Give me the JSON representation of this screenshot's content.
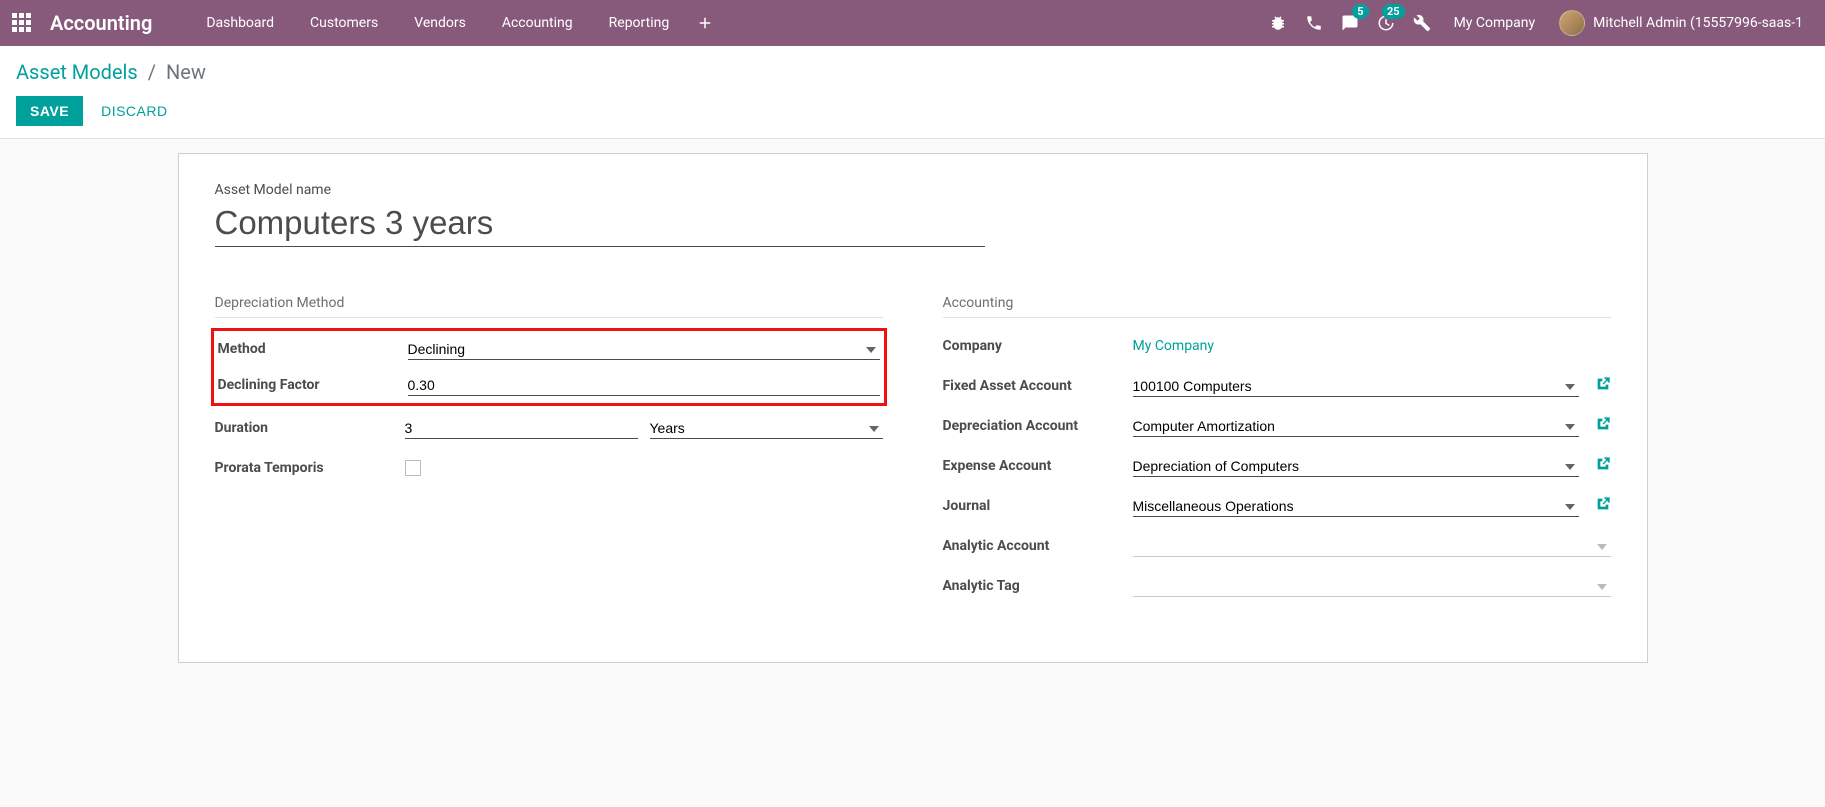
{
  "topbar": {
    "brand": "Accounting",
    "menu": [
      "Dashboard",
      "Customers",
      "Vendors",
      "Accounting",
      "Reporting"
    ],
    "messages_badge": "5",
    "activities_badge": "25",
    "company": "My Company",
    "user": "Mitchell Admin (15557996-saas-1"
  },
  "breadcrumb": {
    "parent": "Asset Models",
    "current": "New"
  },
  "buttons": {
    "save": "SAVE",
    "discard": "DISCARD"
  },
  "form": {
    "title_label": "Asset Model name",
    "title_value": "Computers 3 years",
    "group_left_title": "Depreciation Method",
    "group_right_title": "Accounting",
    "labels": {
      "method": "Method",
      "declining_factor": "Declining Factor",
      "duration": "Duration",
      "prorata": "Prorata Temporis",
      "company": "Company",
      "fixed_asset_account": "Fixed Asset Account",
      "depreciation_account": "Depreciation Account",
      "expense_account": "Expense Account",
      "journal": "Journal",
      "analytic_account": "Analytic Account",
      "analytic_tag": "Analytic Tag"
    },
    "values": {
      "method": "Declining",
      "declining_factor": "0.30",
      "duration_number": "3",
      "duration_unit": "Years",
      "company": "My Company",
      "fixed_asset_account": "100100 Computers",
      "depreciation_account": "Computer Amortization",
      "expense_account": "Depreciation of Computers",
      "journal": "Miscellaneous Operations",
      "analytic_account": "",
      "analytic_tag": ""
    }
  }
}
